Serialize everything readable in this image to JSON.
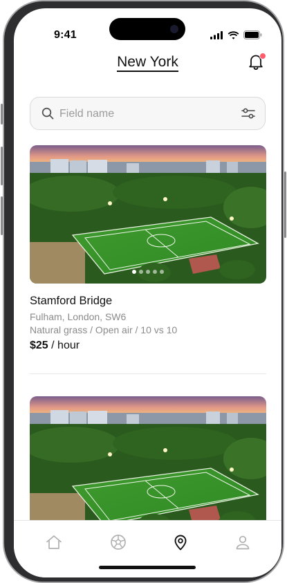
{
  "status": {
    "time": "9:41"
  },
  "header": {
    "title": "New York"
  },
  "search": {
    "placeholder": "Field name",
    "value": ""
  },
  "listings": [
    {
      "name": "Stamford Bridge",
      "address": "Fulham, London, SW6",
      "details": "Natural grass / Open air / 10 vs 10",
      "price": "$25",
      "unit": " / hour",
      "photos": 5,
      "current_photo": 1
    },
    {
      "name": "",
      "address": "",
      "details": "",
      "price": "",
      "unit": "",
      "photos": 5,
      "current_photo": 1
    }
  ],
  "tabs": [
    {
      "icon": "home-icon",
      "active": false
    },
    {
      "icon": "football-icon",
      "active": false
    },
    {
      "icon": "map-pin-icon",
      "active": true
    },
    {
      "icon": "profile-icon",
      "active": false
    }
  ],
  "colors": {
    "notification_dot": "#ff5c6c",
    "active_tab": "#111111",
    "inactive_tab": "#b0b0b0"
  }
}
